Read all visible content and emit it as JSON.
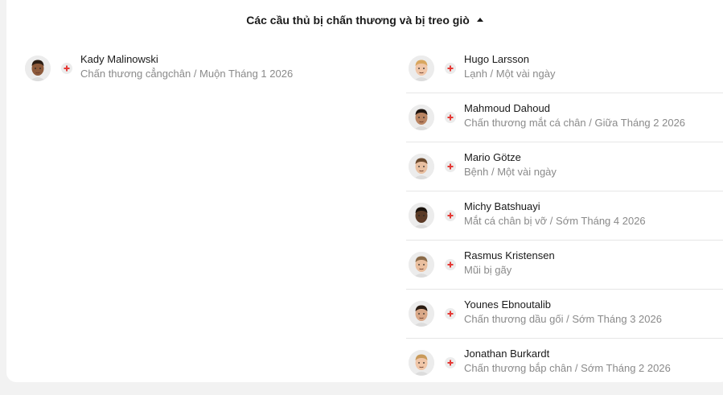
{
  "section": {
    "title": "Các cầu thủ bị chấn thương và bị treo giò",
    "toggle_icon": "caret-up-icon"
  },
  "colors": {
    "injury_cross": "#e53935",
    "text_primary": "#1a1a1a",
    "text_secondary": "#8a8a8a"
  },
  "left_team": [
    {
      "name": "Kady Malinowski",
      "detail": "Chấn thương cẳngchân / Muộn Tháng 1 2026",
      "skin": "#8d5a3b",
      "hair": "#2b1d14"
    }
  ],
  "right_team": [
    {
      "name": "Hugo Larsson",
      "detail": "Lạnh / Một vài ngày",
      "skin": "#f0c6a8",
      "hair": "#d9a760"
    },
    {
      "name": "Mahmoud Dahoud",
      "detail": "Chấn thương mắt cá chân / Giữa Tháng 2 2026",
      "skin": "#b98462",
      "hair": "#1e1510"
    },
    {
      "name": "Mario Götze",
      "detail": "Bệnh / Một vài ngày",
      "skin": "#e8bfa0",
      "hair": "#6b4a2e"
    },
    {
      "name": "Michy Batshuayi",
      "detail": "Mắt cá chân bị vỡ / Sớm Tháng 4 2026",
      "skin": "#5a3a26",
      "hair": "#1a120c"
    },
    {
      "name": "Rasmus Kristensen",
      "detail": "Mũi bị gãy",
      "skin": "#eabf9f",
      "hair": "#8a6a48"
    },
    {
      "name": "Younes Ebnoutalib",
      "detail": "Chấn thương dầu gối / Sớm Tháng 3 2026",
      "skin": "#d9a888",
      "hair": "#2a1c12"
    },
    {
      "name": "Jonathan Burkardt",
      "detail": "Chấn thương bắp chân / Sớm Tháng 2 2026",
      "skin": "#f0c6a8",
      "hair": "#c99a5a"
    }
  ]
}
